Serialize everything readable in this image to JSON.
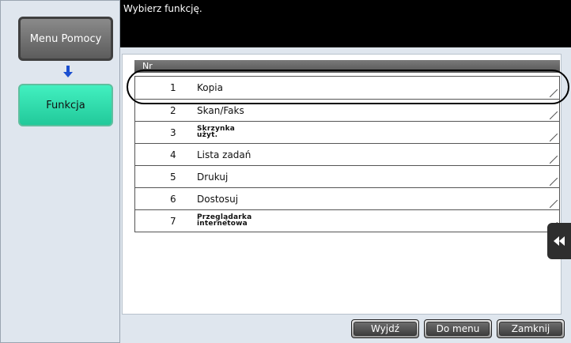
{
  "left_nav": {
    "help_menu_label": "Menu Pomocy",
    "function_label": "Funkcja",
    "arrow_icon": "down-arrow-icon"
  },
  "header": {
    "message": "Wybierz funkcję."
  },
  "table": {
    "column_header": "Nr",
    "rows": [
      {
        "num": "1",
        "label": "Kopia",
        "selected": true
      },
      {
        "num": "2",
        "label": "Skan/Faks"
      },
      {
        "num": "3",
        "label": "Skrzynka użyt."
      },
      {
        "num": "4",
        "label": "Lista zadań"
      },
      {
        "num": "5",
        "label": "Drukuj"
      },
      {
        "num": "6",
        "label": "Dostosuj"
      },
      {
        "num": "7",
        "label": "Przeglądarka internetowa"
      }
    ]
  },
  "side_tab": {
    "icon": "double-left-arrow-icon"
  },
  "footer": {
    "exit_label": "Wyjdź",
    "to_menu_label": "Do menu",
    "close_label": "Zamknij"
  },
  "colors": {
    "background": "#dfe6ee",
    "accent_green": "#22c99a",
    "header_black": "#000000"
  }
}
